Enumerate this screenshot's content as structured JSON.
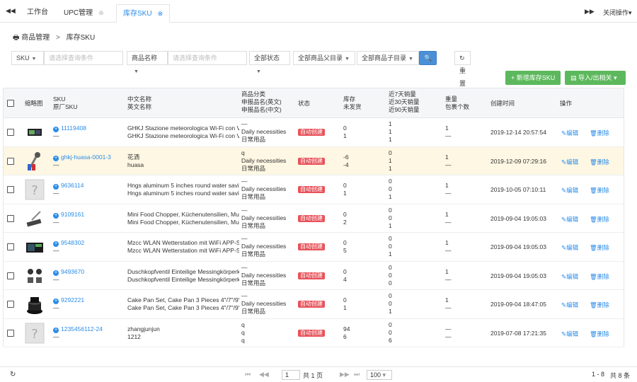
{
  "tabs": {
    "nav_prev": "◀◀",
    "t1": "工作台",
    "t2": "UPC管理",
    "t3": "库存SKU",
    "close": "⊗",
    "nav_next": "▶▶",
    "close_ops": "关闭操作",
    "ops_caret": "▾"
  },
  "breadcrumb": {
    "icon": "🖶",
    "parent": "商品管理",
    "sep": ">",
    "current": "库存SKU"
  },
  "filters": {
    "f1": "SKU",
    "f1_ph": "请选择查询条件",
    "f2": "商品名称",
    "f2_ph": "请选择查询条件",
    "f3": "全部状态",
    "f4": "全部商品父目录",
    "f5": "全部商品子目录",
    "search": "查询",
    "reset": "重置"
  },
  "toolbar": {
    "add": "+ 新增库存SKU",
    "import": "导入/出相关"
  },
  "columns": {
    "thumb": "缩略图",
    "sku": "SKU",
    "factory_sku": "原厂SKU",
    "cn_name": "中文名称",
    "en_name": "英文名称",
    "category": "商品分类",
    "decl_en": "申报品名(英文)",
    "decl_cn": "申报品名(中文)",
    "status": "状态",
    "stock": "库存",
    "unshipped": "未发货",
    "sales7": "近7天销量",
    "sales30": "近30天销量",
    "sales90": "近90天销量",
    "weight": "重量",
    "per_pack": "包裹个数",
    "created": "创建时间",
    "ops": "操作"
  },
  "rows": [
    {
      "sku": "11119408",
      "fsku": "—",
      "cn": "GHKJ Stazione meteorologica Wi-Fi con V",
      "en": "GHKJ Stazione meteorologica Wi-Fi con V",
      "c1": "—",
      "c2": "Daily necessities",
      "c3": "日常用品",
      "status": "自动创建",
      "s1": "0",
      "s2": "1",
      "v1": "1",
      "v2": "1",
      "v3": "1",
      "w": "1",
      "p": "—",
      "time": "2019-12-14 20:57:54"
    },
    {
      "sku": "ghkj-huasa-0001-3",
      "fsku": "—",
      "cn": "花洒",
      "en": "huasa",
      "c1": "q",
      "c2": "Daily necessities",
      "c3": "日常用品",
      "status": "自动创建",
      "s1": "-6",
      "s2": "-4",
      "v1": "0",
      "v2": "1",
      "v3": "1",
      "w": "1",
      "p": "—",
      "time": "2019-12-09 07:29:16"
    },
    {
      "sku": "9636114",
      "fsku": "—",
      "cn": "Hngs aluminum 5 inches round water savi",
      "en": "Hngs aluminum 5 inches round water savi",
      "c1": "—",
      "c2": "Daily necessities",
      "c3": "日常用品",
      "status": "自动创建",
      "s1": "0",
      "s2": "1",
      "v1": "0",
      "v2": "0",
      "v3": "1",
      "w": "1",
      "p": "—",
      "time": "2019-10-05 07:10:11"
    },
    {
      "sku": "9109161",
      "fsku": "—",
      "cn": "Mini Food Chopper, Küchenutensilien, Mul",
      "en": "Mini Food Chopper, Küchenutensilien, Mul",
      "c1": "—",
      "c2": "Daily necessities",
      "c3": "日常用品",
      "status": "自动创建",
      "s1": "0",
      "s2": "2",
      "v1": "0",
      "v2": "0",
      "v3": "1",
      "w": "1",
      "p": "—",
      "time": "2019-09-04 19:05:03"
    },
    {
      "sku": "9548302",
      "fsku": "—",
      "cn": "Mzcc WLAN Wetterstation mit WiFi APP-S",
      "en": "Mzcc WLAN Wetterstation mit WiFi APP-S",
      "c1": "—",
      "c2": "Daily necessities",
      "c3": "日常用品",
      "status": "自动创建",
      "s1": "0",
      "s2": "5",
      "v1": "0",
      "v2": "0",
      "v3": "1",
      "w": "1",
      "p": "—",
      "time": "2019-09-04 19:05:03"
    },
    {
      "sku": "9493670",
      "fsku": "—",
      "cn": "Duschkopfventil Einteilige Messingkörperk",
      "en": "Duschkopfventil Einteilige Messingkörperk",
      "c1": "—",
      "c2": "Daily necessities",
      "c3": "日常用品",
      "status": "自动创建",
      "s1": "0",
      "s2": "4",
      "v1": "0",
      "v2": "0",
      "v3": "0",
      "w": "1",
      "p": "—",
      "time": "2019-09-04 19:05:03"
    },
    {
      "sku": "9292221",
      "fsku": "—",
      "cn": "Cake Pan Set, Cake Pan 3 Pieces 4\"/7\"/9\"",
      "en": "Cake Pan Set, Cake Pan 3 Pieces 4\"/7\"/9\"",
      "c1": "—",
      "c2": "Daily necessities",
      "c3": "日常用品",
      "status": "自动创建",
      "s1": "0",
      "s2": "1",
      "v1": "0",
      "v2": "0",
      "v3": "1",
      "w": "1",
      "p": "—",
      "time": "2019-09-04 18:47:05"
    },
    {
      "sku": "1235456112-24",
      "fsku": "—",
      "cn": "zhangjunjun",
      "en": "1212",
      "c1": "q",
      "c2": "q",
      "c3": "q",
      "status": "自动创建",
      "s1": "94",
      "s2": "6",
      "v1": "0",
      "v2": "0",
      "v3": "6",
      "w": "—",
      "p": "—",
      "time": "2019-07-08 17:21:35"
    }
  ],
  "actions": {
    "edit": "编辑",
    "delete": "删除"
  },
  "pagination": {
    "page": "1",
    "total_pages": "共 1 页",
    "per_page": "100",
    "range": "1 - 8",
    "total": "共 8 条"
  }
}
